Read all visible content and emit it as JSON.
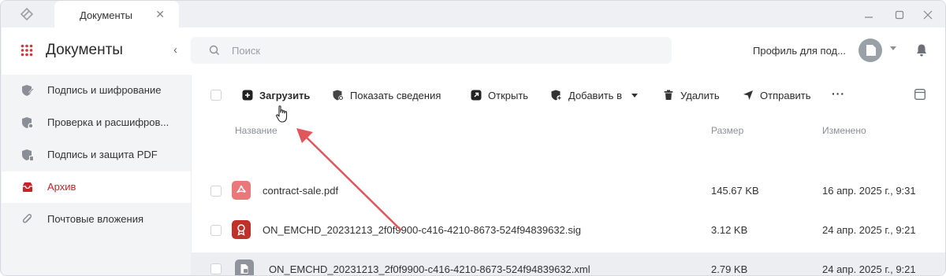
{
  "window": {
    "tab_title": "Документы",
    "tab_close": "✕"
  },
  "header": {
    "app_title": "Документы",
    "collapse": "‹",
    "profile_name": "Профиль для под..."
  },
  "search": {
    "placeholder": "Поиск",
    "value": ""
  },
  "sidebar": {
    "items": [
      {
        "label": "Подпись и шифрование",
        "icon": "shield-pen-icon",
        "active": false
      },
      {
        "label": "Проверка и расшифров...",
        "icon": "shield-check-icon",
        "active": false
      },
      {
        "label": "Подпись и защита PDF",
        "icon": "shield-pdf-icon",
        "active": false
      },
      {
        "label": "Архив",
        "icon": "archive-icon",
        "active": true
      },
      {
        "label": "Почтовые вложения",
        "icon": "paperclip-icon",
        "active": false
      }
    ]
  },
  "toolbar": {
    "upload": "Загрузить",
    "show_info": "Показать сведения",
    "open": "Открыть",
    "add_to": "Добавить в",
    "delete": "Удалить",
    "send": "Отправить",
    "more": "···"
  },
  "table": {
    "columns": {
      "name": "Название",
      "size": "Размер",
      "modified": "Изменено"
    },
    "rows": [
      {
        "name": "contract-sale.pdf",
        "size": "145.67 KB",
        "modified": "16 апр. 2025 г., 9:31",
        "icon": "pdf-icon",
        "color": "#e9787b"
      },
      {
        "name": "ON_EMCHD_20231213_2f0f9900-c416-4210-8673-524f94839632.sig",
        "size": "3.12 KB",
        "modified": "24 апр. 2025 г., 9:21",
        "icon": "signature-icon",
        "color": "#c0312c"
      },
      {
        "name": "ON_EMCHD_20231213_2f0f9900-c416-4210-8673-524f94839632.xml",
        "size": "2.79 KB",
        "modified": "24 апр. 2025 г., 9:21",
        "icon": "xml-icon",
        "color": "#8f949c"
      }
    ]
  },
  "colors": {
    "accent_red": "#c6232b",
    "annotation_arrow": "#e0565b"
  }
}
